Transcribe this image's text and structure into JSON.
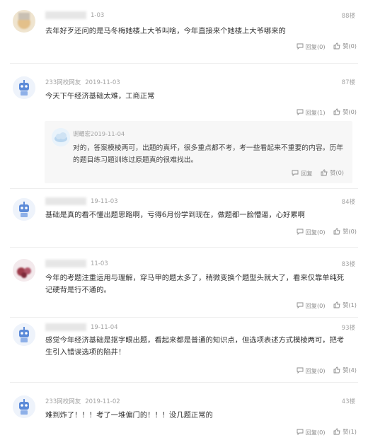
{
  "comments": [
    {
      "user": "",
      "date": "1-03",
      "floor": "88楼",
      "text": "去年好歹还问的是马冬梅她楼上大爷叫啥，今年直接来个她楼上大爷哪来的",
      "reply_label": "回复(0)",
      "like_label": "赞(0)"
    },
    {
      "user": "233网校网友",
      "date": "2019-11-03",
      "floor": "87楼",
      "text": "今天下午经济基础太难，工商正常",
      "reply_label": "回复(1)",
      "like_label": "赞(0)",
      "reply": {
        "user": "谢耀宏",
        "date": "2019-11-04",
        "text": "对的，答案模棱两可，出题的真坏，很多重点都不考，考一些看起来不重要的内容。历年的题目练习题训练过原题真的很难找出。",
        "reply_label": "回复",
        "like_label": "赞(0)"
      }
    },
    {
      "user": "",
      "date": "19-11-03",
      "floor": "84楼",
      "text": "基础是真的看不懂出题思路啊，亏得6月份学到现在，做题都一脸懵逼，心好累啊",
      "reply_label": "回复(0)",
      "like_label": "赞(0)"
    },
    {
      "user": "",
      "date": "11-03",
      "floor": "83楼",
      "text": "今年的考题注重运用与理解，穿马甲的题太多了，稍微变换个题型头就大了，看来仅靠单纯死记硬背是行不通的。",
      "reply_label": "回复(0)",
      "like_label": "赞(1)"
    },
    {
      "user": "",
      "date": "19-11-04",
      "floor": "93楼",
      "text": "感觉今年经济基础是抠字眼出题，看起来都是普通的知识点，但选项表述方式模棱两可，把考生引入错误选项的陷井！",
      "reply_label": "回复(0)",
      "like_label": "赞(4)"
    },
    {
      "user": "233网校网友",
      "date": "2019-11-02",
      "floor": "43楼",
      "text": "难到炸了！！！考了一堆偏门的！！！没几题正常的",
      "reply_label": "回复(0)",
      "like_label": "赞(1)"
    }
  ],
  "colors": {
    "text": "#333333",
    "meta": "#a3a3a3",
    "action": "#8d8d8d",
    "reply_bg": "#f7f7f7",
    "avatar_blue": "#5b8ad8"
  },
  "icons": {
    "reply": "comment-bubble-icon",
    "like": "thumbs-up-icon"
  }
}
